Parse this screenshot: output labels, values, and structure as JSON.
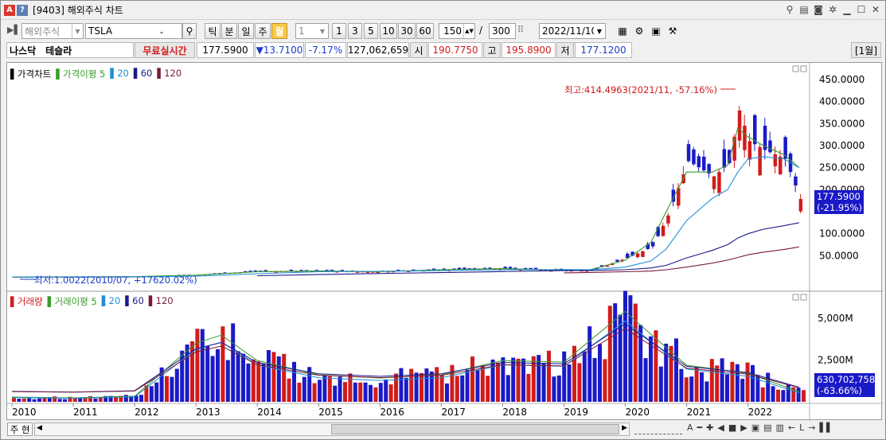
{
  "window": {
    "title": "[9403] 해외주식 차트",
    "logo_label": "A",
    "help_label": "?"
  },
  "toolbar": {
    "market": "해외주식",
    "symbol": "TSLA",
    "periods": [
      "틱",
      "분",
      "일",
      "주",
      "월"
    ],
    "active_period": "월",
    "multiplier": "1",
    "quick_counts": [
      "1",
      "3",
      "5",
      "10",
      "30",
      "60"
    ],
    "display_count": "150",
    "slash": "/",
    "total_count": "300",
    "date": "2022/11/10"
  },
  "info": {
    "exchange": "나스닥",
    "name": "테슬라",
    "realtime_label": "무료실시간",
    "price": "177.5900",
    "change": "▼13.7100",
    "change_pct": "-7.17%",
    "volume": "127,062,659",
    "open_label": "시",
    "open": "190.7750",
    "high_label": "고",
    "high": "195.8900",
    "low_label": "저",
    "low": "177.1200",
    "period_badge": "[1월]"
  },
  "price_legend": [
    {
      "text": "가격차트",
      "color": "#000000"
    },
    {
      "text": "가격이평 5",
      "color": "#3a9a2a"
    },
    {
      "text": "20",
      "color": "#1e8fd6"
    },
    {
      "text": "60",
      "color": "#1a1a8a"
    },
    {
      "text": "120",
      "color": "#7a1a3a"
    }
  ],
  "volume_legend": [
    {
      "text": "거래량",
      "color": "#d21b1b"
    },
    {
      "text": "거래이평 5",
      "color": "#3a9a2a"
    },
    {
      "text": "20",
      "color": "#1e8fd6"
    },
    {
      "text": "60",
      "color": "#1a1a8a"
    },
    {
      "text": "120",
      "color": "#7a1a3a"
    }
  ],
  "annotations": {
    "high": "최고:414.4963(2021/11, -57.16%)",
    "low": "최저:1.0022(2010/07, +17620.02%)"
  },
  "price_axis": [
    "450.0000",
    "400.0000",
    "350.0000",
    "300.0000",
    "250.0000",
    "200.0000",
    "100.0000",
    "50.0000"
  ],
  "price_tag": {
    "value": "177.5900",
    "pct": "(-21.95%)"
  },
  "volume_axis": [
    "5,000M",
    "2,500M"
  ],
  "volume_tag": {
    "value": "630,702,758",
    "pct": "(-63.66%)"
  },
  "x_axis": [
    "2010",
    "2011",
    "2012",
    "2013",
    "2014",
    "2015",
    "2016",
    "2017",
    "2018",
    "2019",
    "2020",
    "2021",
    "2022"
  ],
  "bottom": {
    "label": "주 현"
  },
  "chart_data": {
    "type": "candlestick",
    "symbol": "TSLA",
    "interval": "monthly",
    "ylim": [
      0,
      470
    ],
    "highlight_high": 414.4963,
    "highlight_low": 1.0022,
    "last_close": 177.59,
    "series": [
      {
        "name": "가격차트",
        "x": [
          "2010",
          "2011",
          "2012",
          "2013",
          "2014",
          "2015",
          "2016",
          "2017",
          "2018",
          "2019",
          "2019-06",
          "2020",
          "2020-06",
          "2020-09",
          "2021-01",
          "2021-06",
          "2021-09",
          "2021-11",
          "2022-01",
          "2022-04",
          "2022-08",
          "2022-11"
        ],
        "values": [
          1.5,
          1.8,
          2.2,
          6.5,
          14.5,
          15.5,
          13.5,
          18.5,
          21.5,
          16.5,
          15.5,
          44.5,
          70.0,
          140.0,
          265.0,
          230.0,
          260.0,
          380.0,
          310.0,
          290.0,
          270.0,
          177.59
        ]
      },
      {
        "name": "가격이평 5",
        "values": [
          1.6,
          1.9,
          2.3,
          5.8,
          13.8,
          15.2,
          14.0,
          18.0,
          20.5,
          17.0,
          17.5,
          40.0,
          80.0,
          150.0,
          240.0,
          240.0,
          255.0,
          340.0,
          320.0,
          300.0,
          280.0,
          250.0
        ]
      },
      {
        "name": "20",
        "values": [
          1.5,
          1.6,
          1.9,
          3.5,
          9.0,
          13.5,
          14.5,
          16.0,
          18.0,
          18.5,
          18.0,
          24.0,
          38.0,
          65.0,
          130.0,
          180.0,
          200.0,
          240.0,
          270.0,
          275.0,
          270.0,
          250.0
        ]
      },
      {
        "name": "60",
        "values": [
          null,
          null,
          null,
          null,
          4.5,
          7.0,
          9.5,
          11.5,
          14.0,
          16.0,
          16.5,
          18.0,
          22.0,
          28.0,
          45.0,
          62.0,
          75.0,
          90.0,
          100.0,
          110.0,
          118.0,
          125.0
        ]
      },
      {
        "name": "120",
        "values": [
          null,
          null,
          null,
          null,
          null,
          null,
          null,
          null,
          null,
          11.0,
          12.0,
          13.5,
          15.0,
          18.0,
          24.0,
          33.0,
          40.0,
          46.0,
          52.0,
          58.0,
          64.0,
          70.0
        ]
      }
    ],
    "volume": {
      "name": "거래량",
      "unit": "M",
      "last": 630702758,
      "last_pct": -63.66,
      "ylim": [
        0,
        6000
      ],
      "x": [
        "2010",
        "2011",
        "2012",
        "2013",
        "2013-06",
        "2014",
        "2015",
        "2016",
        "2017",
        "2018",
        "2019",
        "2020",
        "2020-03",
        "2021",
        "2022",
        "2022-11"
      ],
      "values": [
        300,
        250,
        350,
        3700,
        4200,
        2600,
        1700,
        1500,
        1700,
        2600,
        2500,
        5700,
        5100,
        2300,
        1800,
        630
      ]
    }
  }
}
